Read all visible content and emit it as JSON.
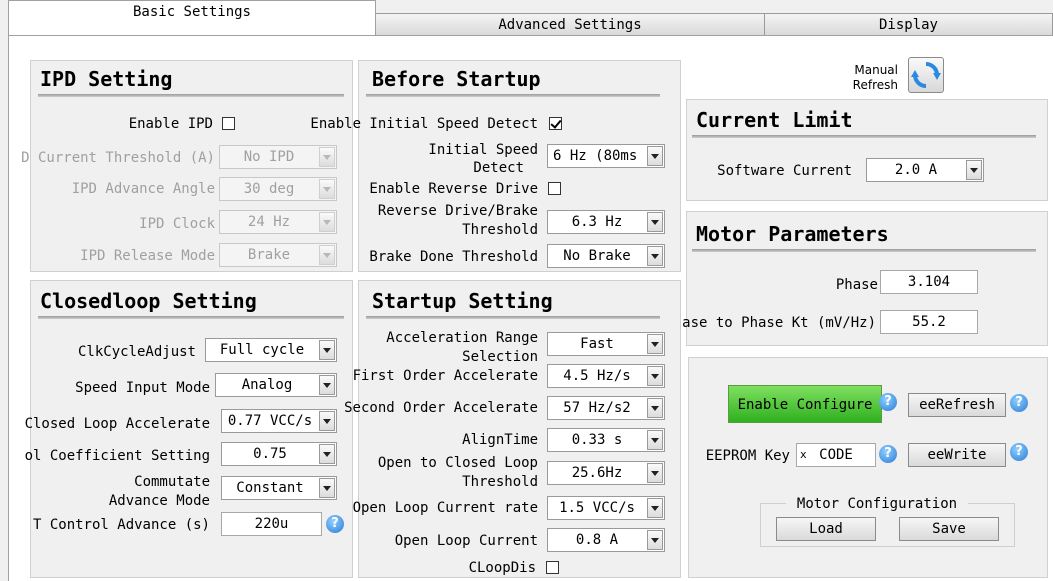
{
  "tabs": [
    "Basic Settings",
    "Advanced Settings",
    "Display"
  ],
  "ipd": {
    "title": "IPD Setting",
    "enable_label": "Enable IPD",
    "enable_checked": false,
    "current_threshold_label": "D Current Threshold (A)",
    "current_threshold_value": "No IPD",
    "advance_angle_label": "IPD Advance Angle",
    "advance_angle_value": "30 deg",
    "clock_label": "IPD Clock",
    "clock_value": "24 Hz",
    "release_mode_label": "IPD Release Mode",
    "release_mode_value": "Brake"
  },
  "before_startup": {
    "title": "Before Startup",
    "initial_speed_detect_label": "Enable Initial Speed Detect",
    "initial_speed_detect_checked": true,
    "initial_speed_label_1": "Initial Speed",
    "initial_speed_label_2": "Detect",
    "initial_speed_value": "6 Hz (80ms",
    "reverse_drive_label": "Enable Reverse Drive",
    "reverse_drive_checked": false,
    "reverse_threshold_label_1": "Reverse Drive/Brake",
    "reverse_threshold_label_2": "Threshold",
    "reverse_threshold_value": "6.3 Hz",
    "brake_done_label": "Brake Done Threshold",
    "brake_done_value": "No Brake"
  },
  "manual_refresh": {
    "line1": "Manual",
    "line2": "Refresh"
  },
  "current_limit": {
    "title": "Current Limit",
    "software_current_label": "Software Current",
    "software_current_value": "2.0 A"
  },
  "motor_parameters": {
    "title": "Motor Parameters",
    "phase_label": "Phase",
    "phase_value": "3.104",
    "kt_label": "Phase to Phase Kt (mV/Hz)",
    "kt_value": "55.2"
  },
  "closedloop": {
    "title": "Closedloop Setting",
    "clk_cycle_label": "ClkCycleAdjust",
    "clk_cycle_value": "Full cycle",
    "speed_input_label": "Speed Input Mode",
    "speed_input_value": "Analog",
    "cl_accel_label": "Closed Loop Accelerate",
    "cl_accel_value": "0.77 VCC/s",
    "coeff_label": "ol Coefficient Setting",
    "coeff_value": "0.75",
    "commutate_label_1": "Commutate",
    "commutate_label_2": "Advance Mode",
    "commutate_value": "Constant",
    "t_control_label": "T Control Advance (s)",
    "t_control_value": "220u"
  },
  "startup": {
    "title": "Startup Setting",
    "accel_range_label_1": "Acceleration Range",
    "accel_range_label_2": "Selection",
    "accel_range_value": "Fast",
    "first_order_label": "First Order Accelerate",
    "first_order_value": "4.5 Hz/s",
    "second_order_label": "Second Order Accelerate",
    "second_order_value": "57 Hz/s2",
    "align_time_label": "AlignTime",
    "align_time_value": "0.33 s",
    "open_closed_label_1": "Open to Closed Loop",
    "open_closed_label_2": "Threshold",
    "open_closed_value": "25.6Hz",
    "ol_current_rate_label": "Open Loop Current rate",
    "ol_current_rate_value": "1.5 VCC/s",
    "ol_current_label": "Open Loop Current",
    "ol_current_value": "0.8 A",
    "cloopdis_label": "CLoopDis",
    "cloopdis_checked": false
  },
  "config": {
    "enable_configure_label": "Enable Configure",
    "ee_refresh_label": "eeRefresh",
    "eeprom_key_label": "EEPROM Key",
    "eeprom_key_prefix": "x",
    "eeprom_key_value": "CODE",
    "ee_write_label": "eeWrite",
    "motor_config_title": "Motor Configuration",
    "load_label": "Load",
    "save_label": "Save"
  },
  "icons": {
    "help_glyph": "?"
  }
}
